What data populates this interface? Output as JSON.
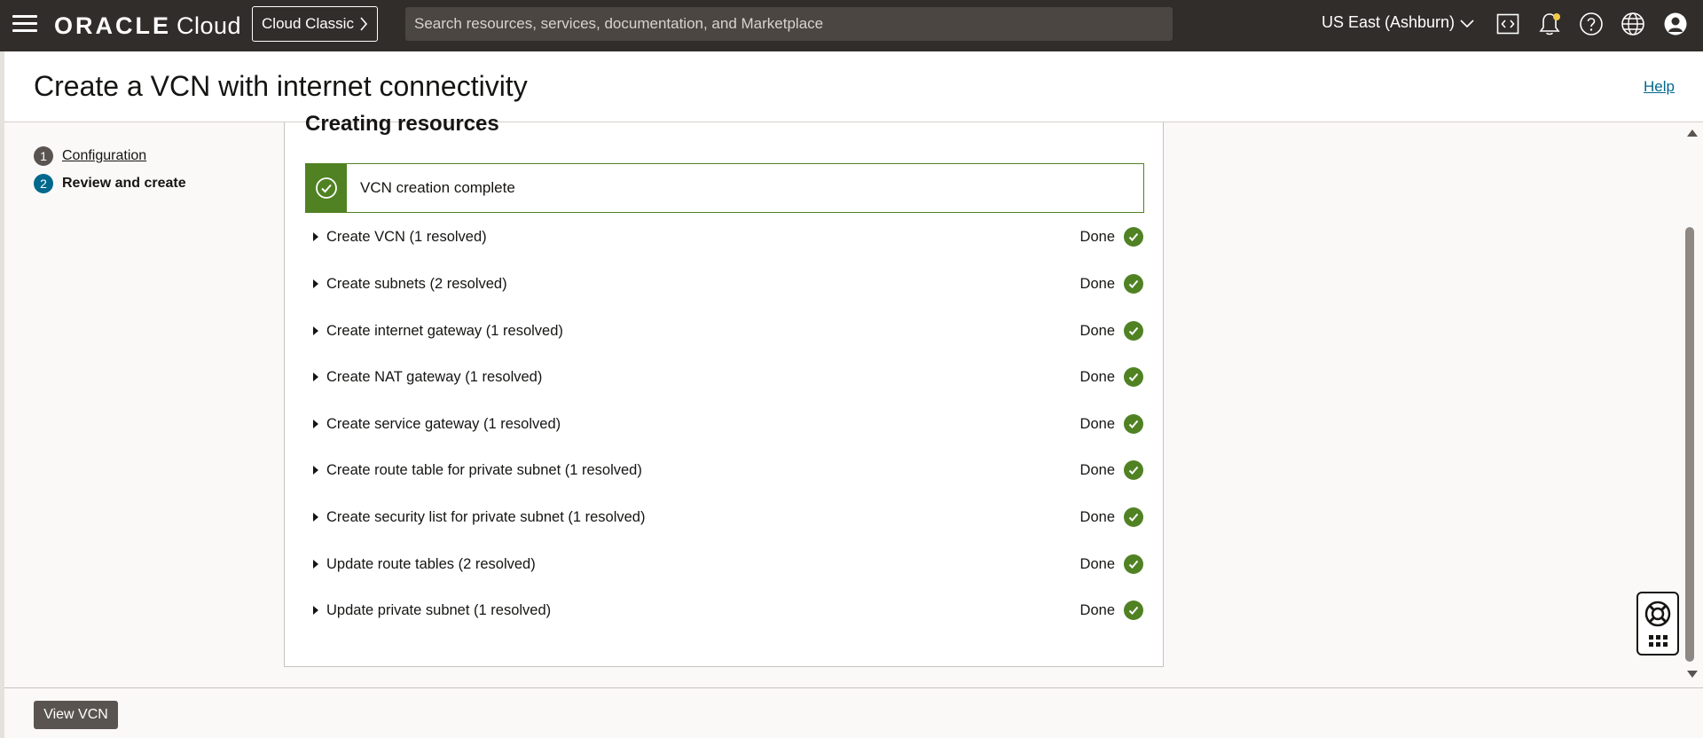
{
  "nav": {
    "brand": "ORACLE",
    "product": "Cloud",
    "classic_label": "Cloud Classic",
    "search_placeholder": "Search resources, services, documentation, and Marketplace",
    "region": "US East (Ashburn)"
  },
  "header": {
    "title": "Create a VCN with internet connectivity",
    "help": "Help"
  },
  "steps": [
    {
      "number": "1",
      "label": "Configuration",
      "state": "completed"
    },
    {
      "number": "2",
      "label": "Review and create",
      "state": "current"
    }
  ],
  "panel": {
    "title": "Creating resources",
    "banner": "VCN creation complete",
    "tasks": [
      {
        "label": "Create VCN (1 resolved)",
        "status": "Done"
      },
      {
        "label": "Create subnets (2 resolved)",
        "status": "Done"
      },
      {
        "label": "Create internet gateway (1 resolved)",
        "status": "Done"
      },
      {
        "label": "Create NAT gateway (1 resolved)",
        "status": "Done"
      },
      {
        "label": "Create service gateway (1 resolved)",
        "status": "Done"
      },
      {
        "label": "Create route table for private subnet (1 resolved)",
        "status": "Done"
      },
      {
        "label": "Create security list for private subnet (1 resolved)",
        "status": "Done"
      },
      {
        "label": "Update route tables (2 resolved)",
        "status": "Done"
      },
      {
        "label": "Update private subnet (1 resolved)",
        "status": "Done"
      }
    ]
  },
  "footer": {
    "view_button": "View VCN"
  },
  "colors": {
    "topbar": "#312d2a",
    "success": "#508223",
    "link": "#00688c",
    "step_active": "#00688c"
  },
  "icons": [
    "menu-icon",
    "code-editor-icon",
    "bell-icon",
    "help-icon",
    "globe-icon",
    "user-icon",
    "checkmark-icon",
    "lifebuoy-icon",
    "grid-icon"
  ]
}
